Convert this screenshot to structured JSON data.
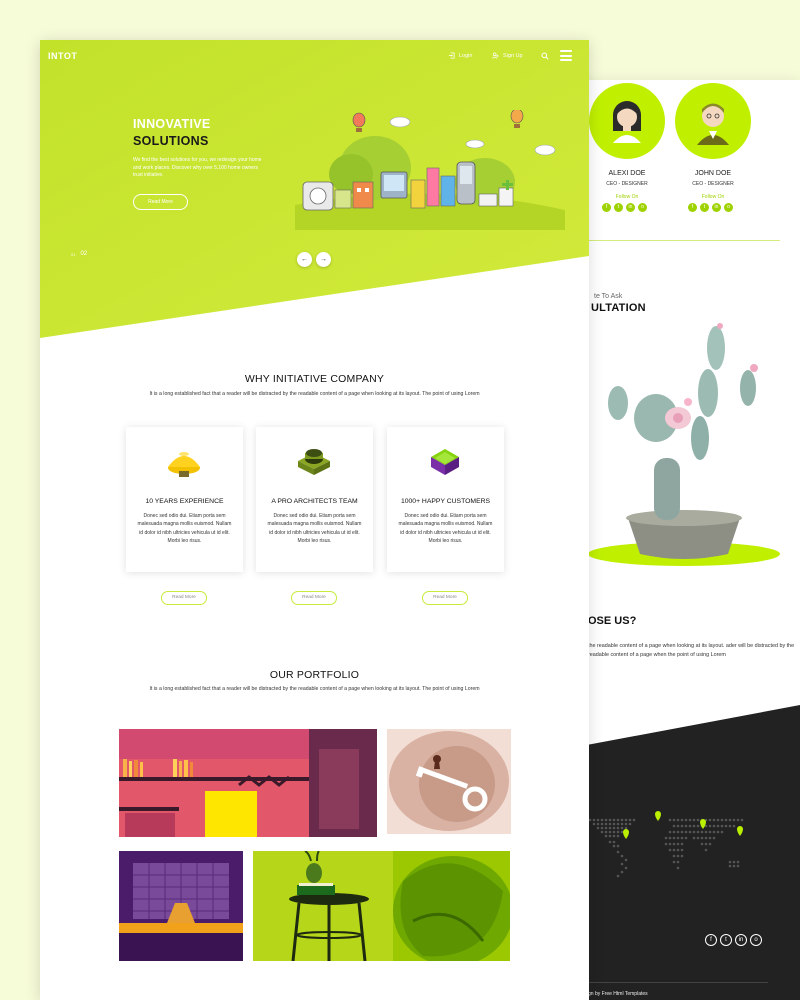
{
  "colors": {
    "accent": "#c7e626",
    "accent_bright": "#baf000",
    "dark": "#222222",
    "text": "#111111",
    "page_bg": "#f6fbd8"
  },
  "front": {
    "logo": "INTOT",
    "nav": {
      "login": "Login",
      "signup": "Sign Up",
      "login_icon": "login-icon",
      "signup_icon": "user-plus-icon",
      "search_icon": "search-icon",
      "menu_icon": "hamburger-menu-icon"
    },
    "hero": {
      "title_line1": "INNOVATIVE",
      "title_line2": "SOLUTIONS",
      "text": "We find the best solutions for you, we redesign your home and work places. Discover why over 5,100 home owners trust initiative.",
      "button": "Read More",
      "counter_current": "01",
      "counter_total": "02",
      "prev_icon": "arrow-left-icon",
      "next_icon": "arrow-right-icon"
    },
    "why": {
      "title": "WHY INITIATIVE COMPANY",
      "subtitle": "It is a long established fact that a reader will be distracted by the readable content of a page when looking at its layout. The point of using Lorem",
      "cards": [
        {
          "title": "10 YEARS EXPERIENCE",
          "text": "Donec sed odio dui. Etiam porta sem malesuada magna mollis euismod. Nullam id dolor id nibh ultricies vehicula ut id elit. Morbi leo risus.",
          "button": "Read More",
          "icon": "yellow-cone-icon"
        },
        {
          "title": "A PRO ARCHITECTS TEAM",
          "text": "Donec sed odio dui. Etiam porta sem malesuada magna mollis euismod. Nullam id dolor id nibh ultricies vehicula ut id elit. Morbi leo risus.",
          "button": "Read More",
          "icon": "green-well-icon"
        },
        {
          "title": "1000+ HAPPY CUSTOMERS",
          "text": "Donec sed odio dui. Etiam porta sem malesuada magna mollis euismod. Nullam id dolor id nibh ultricies vehicula ut id elit. Morbi leo risus.",
          "button": "Read More",
          "icon": "purple-box-icon"
        }
      ]
    },
    "portfolio": {
      "title": "OUR PORTFOLIO",
      "subtitle": "It is a long established fact that a reader will be distracted by the readable content of a page when looking at its layout. The point of using Lorem",
      "items": [
        "bookshelf-room-image",
        "key-keyhole-image",
        "purple-room-image",
        "green-table-image"
      ]
    }
  },
  "back": {
    "team": [
      {
        "name": "ALEXI DOE",
        "role": "CEO - DESIGNER",
        "follow": "Follow On"
      },
      {
        "name": "JOHN DOE",
        "role": "CEO - DESIGNER",
        "follow": "Follow On"
      }
    ],
    "social_icons": [
      "f",
      "t",
      "in",
      "o"
    ],
    "consult_sub": "te To Ask",
    "consult_heading": "ULTATION",
    "choose_heading": "OSE US?",
    "choose_text": "the readable content of a page when looking at its layout. ader will be distracted by the readable content of a page when the point of using Lorem",
    "credit": "gn by Free Html Templates"
  }
}
